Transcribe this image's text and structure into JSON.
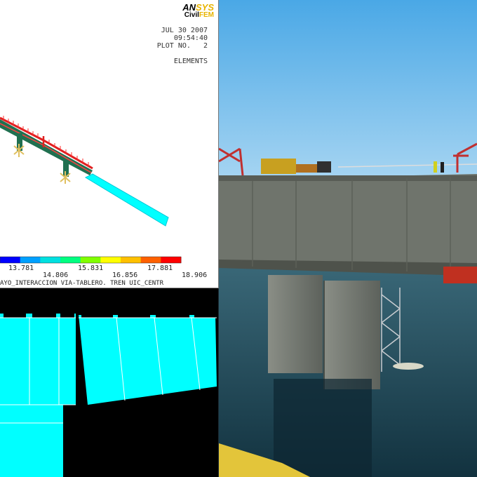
{
  "fem_plot": {
    "logo_primary": "ANSYS",
    "logo_secondary": "CivilFEM",
    "date": "JUL 30 2007",
    "time": "09:54:40",
    "plot_label": "PLOT NO.   2",
    "mode": "ELEMENTS",
    "legend": {
      "ticks_top": [
        "13.781",
        "15.831",
        "17.881"
      ],
      "ticks_bottom": [
        "14.806",
        "16.856",
        "18.906"
      ],
      "colors": [
        "#0000ff",
        "#00a0ff",
        "#00e0e0",
        "#00ff80",
        "#80ff00",
        "#ffff00",
        "#ffc000",
        "#ff6000",
        "#ff0000"
      ]
    },
    "subtitle": "AYO_INTERACCION VIA-TABLERO. TREN UIC_CENTR"
  },
  "colors": {
    "element_fill": "#00ffff",
    "rail": "#e02020",
    "deck_green": "#207050",
    "support": "#e0c060"
  }
}
